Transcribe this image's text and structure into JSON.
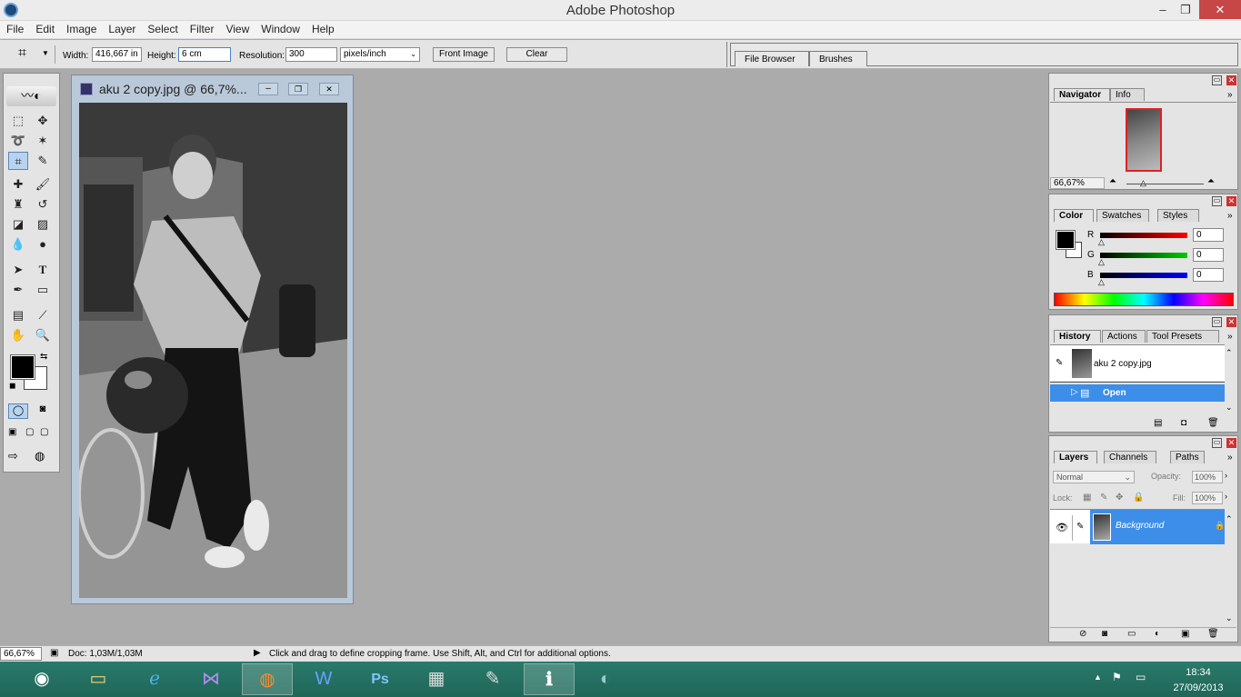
{
  "window": {
    "title": "Adobe Photoshop",
    "minimize": "–",
    "maximize": "❐",
    "close": "✕"
  },
  "menu": [
    "File",
    "Edit",
    "Image",
    "Layer",
    "Select",
    "Filter",
    "View",
    "Window",
    "Help"
  ],
  "options": {
    "width_label": "Width:",
    "width_value": "416,667 in",
    "height_label": "Height:",
    "height_value": "6 cm",
    "resolution_label": "Resolution:",
    "resolution_value": "300",
    "units_value": "pixels/inch",
    "front_image": "Front Image",
    "clear": "Clear"
  },
  "well_tabs": [
    "File Browser",
    "Brushes"
  ],
  "document": {
    "title": "aku 2 copy.jpg @ 66,7%..."
  },
  "navigator": {
    "tabs": [
      "Navigator",
      "Info"
    ],
    "zoom": "66,67%"
  },
  "color": {
    "tabs": [
      "Color",
      "Swatches",
      "Styles"
    ],
    "r_label": "R",
    "g_label": "G",
    "b_label": "B",
    "r_value": "0",
    "g_value": "0",
    "b_value": "0"
  },
  "history": {
    "tabs": [
      "History",
      "Actions",
      "Tool Presets"
    ],
    "snapshot": "aku 2 copy.jpg",
    "step": "Open"
  },
  "layers": {
    "tabs": [
      "Layers",
      "Channels",
      "Paths"
    ],
    "blend_mode": "Normal",
    "opacity_label": "Opacity:",
    "opacity_value": "100%",
    "lock_label": "Lock:",
    "fill_label": "Fill:",
    "fill_value": "100%",
    "layer_name": "Background"
  },
  "status": {
    "zoom": "66,67%",
    "doc": "Doc: 1,03M/1,03M",
    "hint": "Click and drag to define cropping frame. Use Shift, Alt, and Ctrl for additional options."
  },
  "taskbar": {
    "time": "18:34",
    "date": "27/09/2013"
  },
  "colors": {
    "accent": "#3399ff",
    "selection": "#3d8ee8"
  }
}
